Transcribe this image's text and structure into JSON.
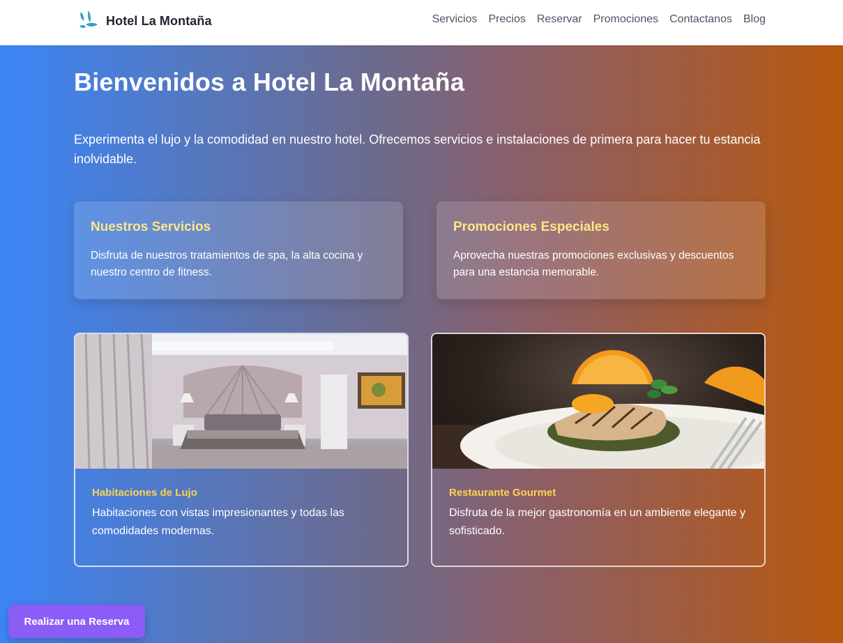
{
  "brand": {
    "name": "Hotel La Montaña",
    "logo_icon": "water-drops-icon",
    "logo_color": "#3aa0c9"
  },
  "nav": {
    "links": [
      "Servicios",
      "Precios",
      "Reservar",
      "Promociones",
      "Contactanos",
      "Blog"
    ]
  },
  "hero": {
    "title": "Bienvenidos a Hotel La Montaña",
    "text": "Experimenta el lujo y la comodidad en nuestro hotel. Ofrecemos servicios e instalaciones de primera para hacer tu estancia inolvidable."
  },
  "info_cards": [
    {
      "title": "Nuestros Servicios",
      "text": "Disfruta de nuestros tratamientos de spa, la alta cocina y nuestro centro de fitness."
    },
    {
      "title": "Promociones Especiales",
      "text": "Aprovecha nuestras promociones exclusivas y descuentos para una estancia memorable."
    }
  ],
  "features": [
    {
      "title": "Habitaciones de Lujo",
      "text": "Habitaciones con vistas impresionantes y todas las comodidades modernas.",
      "image": "hotel-bedroom-photo"
    },
    {
      "title": "Restaurante Gourmet",
      "text": "Disfruta de la mejor gastronomía en un ambiente elegante y sofisticado.",
      "image": "gourmet-dish-photo"
    }
  ],
  "cta": {
    "label": "Realizar una Reserva"
  },
  "colors": {
    "accent_yellow": "#fcd34d",
    "cta_purple": "#8b5cf6",
    "gradient_start": "#3b86f6",
    "gradient_end": "#b7580f"
  }
}
